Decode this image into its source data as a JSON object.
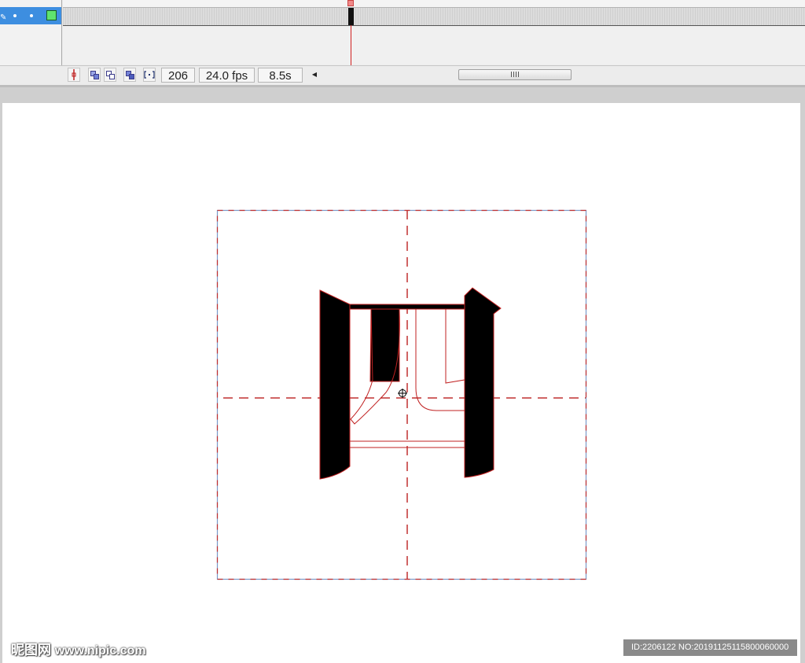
{
  "timeline": {
    "layer_icons": [
      "pencil-icon",
      "eye-dot-icon",
      "lock-dot-icon",
      "outline-box-icon"
    ],
    "outline_color": "#5fe36f",
    "layer_highlight": "#3d8ee0",
    "current_frame": "206",
    "frame_rate": "24.0 fps",
    "elapsed_time": "8.5s",
    "scroll_left_glyph": "◀"
  },
  "stage": {
    "glyph": "四",
    "guide_color": "#c03030",
    "box_color": "#7a9ac8"
  },
  "watermarks": {
    "site_name": "昵图网",
    "site_url": "www.nipic.com",
    "image_id": "ID:2206122 NO:20191125115800060000"
  }
}
